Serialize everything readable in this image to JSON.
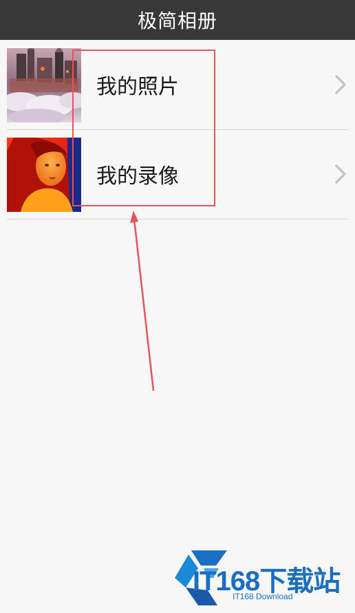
{
  "app": {
    "title": "极简相册"
  },
  "list": {
    "items": [
      {
        "label": "我的照片",
        "thumbnail": "castle-in-clouds-painting"
      },
      {
        "label": "我的录像",
        "thumbnail": "woman-portrait-red"
      }
    ]
  },
  "watermark": {
    "logo_text": "IT168下载站",
    "sub_text": "IT168 Download"
  },
  "colors": {
    "title_bar": "#383838",
    "background": "#f7f7f7",
    "annotation": "#e8525a",
    "watermark": "#1a6fc2"
  }
}
